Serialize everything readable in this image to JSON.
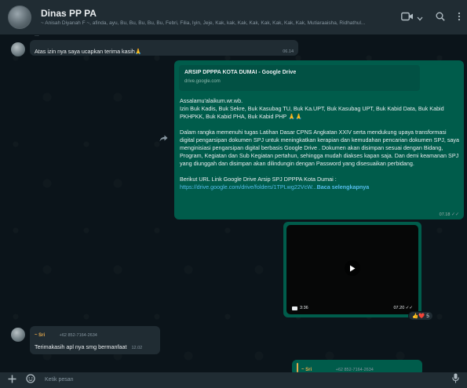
{
  "header": {
    "title": "Dinas PP PA",
    "members": "~ Anisah Diyanah F ~, afinda, ayu, Bu, Bu, Bu, Bu, Bu, Febri, Filia, Iyin, Jeje, Kak, kak, Kak, Kak, Kak, Kak, Kak, Kak, Mutiaraaisha, Ridhathul...",
    "video_icon": "video-camera-icon",
    "dropdown_icon": "chevron-down-icon",
    "search_icon": "search-icon",
    "menu_icon": "kebab-menu-icon"
  },
  "messages": {
    "cut_top": "...",
    "thanks": {
      "text": "Atas izin nya saya ucapkan terima kasih🙏",
      "time": "06.14"
    },
    "drive": {
      "preview_title": "ARSIP DPPPA KOTA DUMAI - Google Drive",
      "preview_domain": "drive.google.com",
      "greeting": "Assalamu'alaikum.wr.wb.",
      "intro": "Izin Buk Kadis, Buk Sekre, Buk Kasubag TU, Buk Ka.UPT, Buk Kasubag UPT, Buk Kabid Data, Buk Kabid PKHPKK, Buk Kabid PHA, Buk Kabid PHP 🙏🙏",
      "body": "Dalam rangka memenuhi tugas Latihan Dasar CPNS Angkatan XXIV serta mendukung upaya transformasi digital pengarsipan dokumen SPJ untuk meningkatkan kerapian dan kemudahan pencarian dokumen SPJ, saya menginisiasi pengarsipan digital berbasis Google Drive . Dokumen akan disimpan sesuai dengan Bidang, Program, Kegiatan dan Sub Kegiatan pertahun, sehingga mudah diakses kapan saja. Dan demi keamanan SPJ yang diunggah dan disimpan akan dilindungin dengan Password yang disesuaikan perbidang.",
      "link_intro": "Berikut URL Link Google Drive Arsip SPJ DPPPA Kota Dumai :",
      "link_url": "https://drive.google.com/drive/folders/1TPLwg22VcW...",
      "read_more": "Baca selengkapnya",
      "time": "07.18",
      "ticks": "✓✓"
    },
    "video": {
      "duration": "3:36",
      "time": "07.20",
      "ticks": "✓✓",
      "reactions": "👍❤️",
      "reaction_count": "5"
    },
    "sri_msg": {
      "sender": "~ Sri",
      "phone": "+62 852-7164-2634",
      "text": "Terimakasih apl nya smg bermanfaat",
      "time": "12.02"
    },
    "reply_preview": {
      "sender": "~ Sri",
      "phone": "+62 852-7164-2634"
    }
  },
  "footer": {
    "attach_icon": "plus-icon",
    "emoji_icon": "sticker-icon",
    "placeholder": "Ketik pesan",
    "mic_icon": "microphone-icon"
  },
  "colors": {
    "header_bg": "#202c33",
    "chat_bg": "#0b141a",
    "bubble_in": "#202c33",
    "bubble_out": "#005c4b",
    "link": "#53bdeb",
    "sender_name": "#e5a94c"
  }
}
